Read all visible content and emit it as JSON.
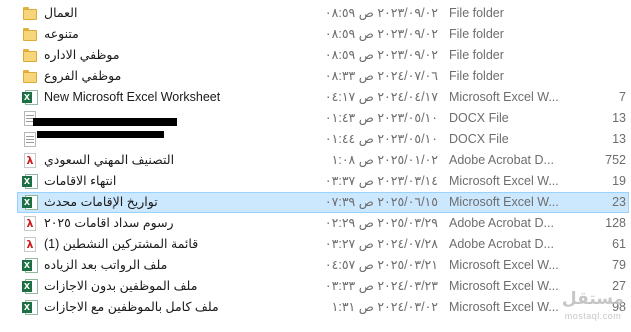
{
  "file_list": {
    "items": [
      {
        "icon": "folder-icon",
        "name": "العمال",
        "date": "٢٠٢٣/٠٩/٠٢ ص ٠٨:٥٩",
        "type": "File folder",
        "size": ""
      },
      {
        "icon": "folder-icon",
        "name": "متنوعه",
        "date": "٢٠٢٣/٠٩/٠٢ ص ٠٨:٥٩",
        "type": "File folder",
        "size": ""
      },
      {
        "icon": "folder-icon",
        "name": "موظفي الاداره",
        "date": "٢٠٢٣/٠٩/٠٢ ص ٠٨:٥٩",
        "type": "File folder",
        "size": ""
      },
      {
        "icon": "folder-icon",
        "name": "موظفي الفروع",
        "date": "٢٠٢٤/٠٧/٠٦ ص ٠٨:٣٣",
        "type": "File folder",
        "size": ""
      },
      {
        "icon": "excel-icon",
        "name": "New Microsoft Excel Worksheet",
        "date": "٢٠٢٤/٠٤/١٧ ص ٠٤:١٧",
        "type": "Microsoft Excel W...",
        "size": "7"
      },
      {
        "icon": "docx-icon",
        "name": "",
        "date": "٢٠٢٣/٠٥/١٠ ص ٠١:٤٣",
        "type": "DOCX File",
        "size": "13"
      },
      {
        "icon": "docx-icon",
        "name": "",
        "date": "٢٠٢٣/٠٥/١٠ ص ٠١:٤٤",
        "type": "DOCX File",
        "size": "13"
      },
      {
        "icon": "pdf-icon",
        "name": "التصنيف المهني السعودي",
        "date": "٢٠٢٥/٠١/٠٢ ص ١:٠٨",
        "type": "Adobe Acrobat D...",
        "size": "752"
      },
      {
        "icon": "excel-icon",
        "name": "انتهاء الاقامات",
        "date": "٢٠٢٣/٠٣/١٤ ص ٠٣:٣٧",
        "type": "Microsoft Excel W...",
        "size": "19"
      },
      {
        "icon": "excel-icon",
        "name": "تواريخ الإقامات محدث",
        "date": "٢٠٢٥/٠٦/١٥ ص ٠٧:٣٩",
        "type": "Microsoft Excel W...",
        "size": "23"
      },
      {
        "icon": "pdf-icon",
        "name": "رسوم سداد اقامات ٢٠٢٥",
        "date": "٢٠٢٥/٠٣/٢٩ ص ٠٢:٢٩",
        "type": "Adobe Acrobat D...",
        "size": "128"
      },
      {
        "icon": "pdf-icon",
        "name": "(1) قائمة المشتركين النشطين",
        "date": "٢٠٢٤/٠٧/٢٨ ص ٠٣:٢٧",
        "type": "Adobe Acrobat D...",
        "size": "61"
      },
      {
        "icon": "excel-icon",
        "name": "ملف الرواتب بعد الزياده",
        "date": "٢٠٢٥/٠٣/٢١ ص ٠٤:٥٧",
        "type": "Microsoft Excel W...",
        "size": "79"
      },
      {
        "icon": "excel-icon",
        "name": "ملف الموظفين بدون الاجازات",
        "date": "٢٠٢٤/٠٣/٢٣ ص ٠٣:٣٣",
        "type": "Microsoft Excel W...",
        "size": "27"
      },
      {
        "icon": "excel-icon",
        "name": "ملف كامل بالموظفين مع الاجازات",
        "date": "٢٠٢٤/٠٣/٠٢ ص ١:٣١",
        "type": "Microsoft Excel W...",
        "size": "98"
      }
    ],
    "selected_index": 9
  },
  "watermark": {
    "logo": "مستقل",
    "text": "mostaql.com"
  },
  "colors": {
    "selection_background": "#cce8ff",
    "selection_border": "#99d1ff",
    "secondary_text": "#6d6d6d",
    "folder": "#f7d57a",
    "excel": "#1d7044",
    "pdf": "#d01b1b"
  }
}
